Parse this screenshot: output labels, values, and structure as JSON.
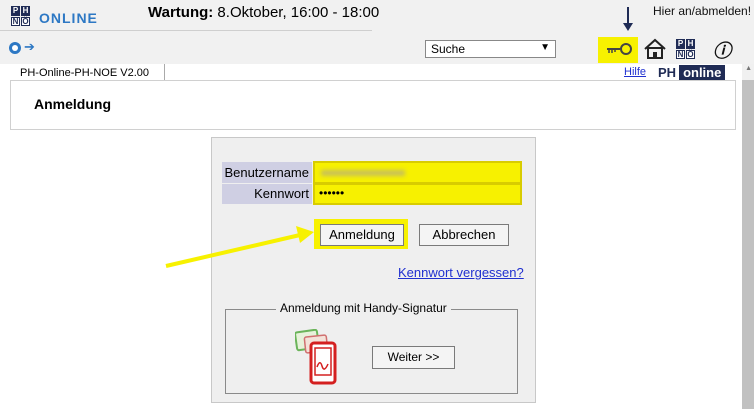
{
  "header": {
    "brand_text": "ONLINE",
    "maintenance_label": "Wartung:",
    "maintenance_text": " 8.Oktober, 16:00 - 18:00",
    "login_link": "Hier an/abmelden!",
    "search_select_value": "Suche"
  },
  "logo": {
    "tl": "P",
    "tr": "H",
    "bl": "N",
    "br": "Ö"
  },
  "subheader": {
    "tab_label": "PH-Online-PH-NOE V2.00",
    "help_link": "Hilfe",
    "ph_logo_ph": "PH",
    "ph_logo_online": "online"
  },
  "page": {
    "title": "Anmeldung"
  },
  "login": {
    "username_label": "Benutzername",
    "password_label": "Kennwort",
    "password_value": "••••••",
    "login_button": "Anmeldung",
    "cancel_button": "Abbrechen",
    "forgot_link": "Kennwort vergessen?",
    "handy_legend": "Anmeldung mit Handy-Signatur",
    "next_button": "Weiter >>"
  },
  "icons": [
    "down-arrow-icon",
    "key-icon",
    "home-icon",
    "phno-icon",
    "info-icon",
    "nav-circle-icon",
    "nav-arrow-icon",
    "phone-signature-icon"
  ],
  "colors": {
    "highlight": "#f7f100",
    "brand_blue": "#2d78c4",
    "navy": "#1f2b55",
    "link": "#2030d0"
  }
}
